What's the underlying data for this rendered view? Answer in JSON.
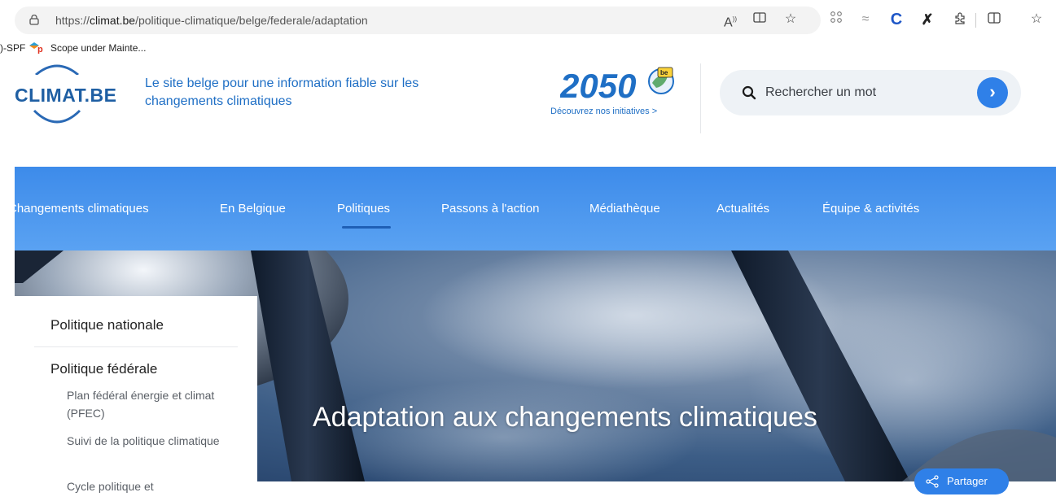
{
  "browser": {
    "url_prefix": "https://",
    "url_domain": "climat.be",
    "url_path": "/politique-climatique/belge/federale/adaptation",
    "read_aloud_label": "A",
    "bookmarks": [
      {
        "label": ")-SPF"
      },
      {
        "label": "Scope under Mainte..."
      }
    ]
  },
  "header": {
    "logo": "CLIMAT.BE",
    "tagline": "Le site belge pour une information fiable sur les changements climatiques",
    "promo_logo_text": "2050",
    "promo_badge": "be",
    "promo_link": "Découvrez nos initiatives >",
    "search_placeholder": "Rechercher un mot",
    "search_button": "›"
  },
  "nav": {
    "items": [
      {
        "label": "Changements climatiques"
      },
      {
        "label": "En Belgique"
      },
      {
        "label": "Politiques"
      },
      {
        "label": "Passons à l'action"
      },
      {
        "label": "Médiathèque"
      },
      {
        "label": "Actualités"
      },
      {
        "label": "Équipe & activités"
      }
    ],
    "active_index": 2
  },
  "hero": {
    "title": "Adaptation aux changements climatiques"
  },
  "share": {
    "label": "Partager"
  },
  "sidebar": {
    "items": [
      {
        "label": "Politique nationale"
      },
      {
        "label": "Politique fédérale"
      }
    ],
    "subitems": [
      {
        "label": "Plan fédéral énergie et climat (PFEC)"
      },
      {
        "label": "Suivi de la politique climatique"
      },
      {
        "label": "Cycle politique et"
      }
    ]
  },
  "colors": {
    "brand_blue": "#1f6fc5",
    "nav_blue": "#3d8bea",
    "accent_button": "#2f80e8"
  }
}
